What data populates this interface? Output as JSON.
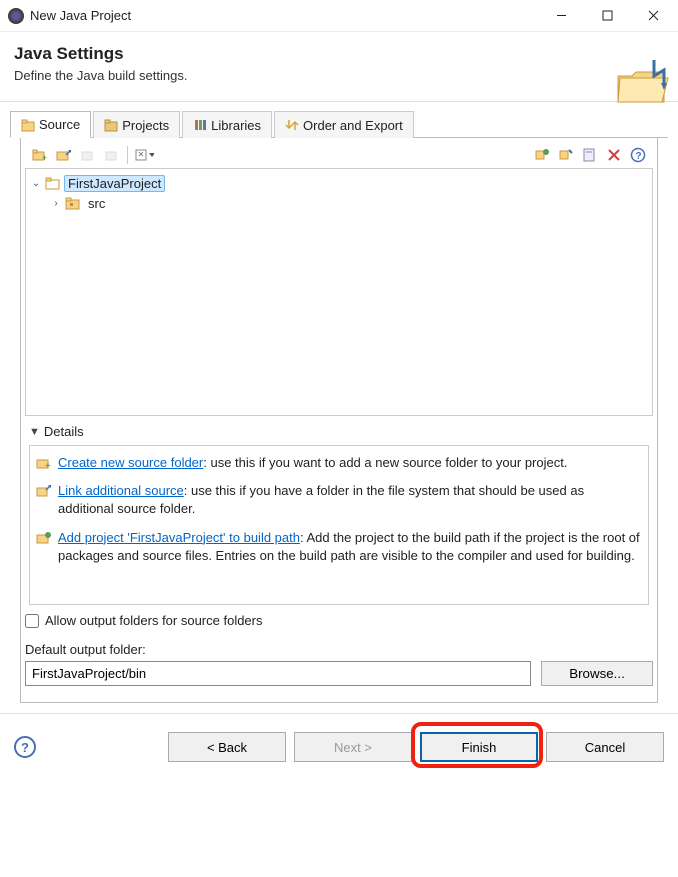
{
  "window": {
    "title": "New Java Project"
  },
  "header": {
    "title": "Java Settings",
    "subtitle": "Define the Java build settings."
  },
  "tabs": {
    "source": "Source",
    "projects": "Projects",
    "libraries": "Libraries",
    "order": "Order and Export"
  },
  "tree": {
    "project": "FirstJavaProject",
    "src": "src"
  },
  "details": {
    "heading": "Details",
    "item1_link": "Create new source folder",
    "item1_rest": ": use this if you want to add a new source folder to your project.",
    "item2_link": "Link additional source",
    "item2_rest": ": use this if you have a folder in the file system that should be used as additional source folder.",
    "item3_link": "Add project 'FirstJavaProject' to build path",
    "item3_rest": ": Add the project to the build path if the project is the root of packages and source files. Entries on the build path are visible to the compiler and used for building."
  },
  "allow_output_label": "Allow output folders for source folders",
  "output_label": "Default output folder:",
  "output_value": "FirstJavaProject/bin",
  "browse_label": "Browse...",
  "buttons": {
    "back": "< Back",
    "next": "Next >",
    "finish": "Finish",
    "cancel": "Cancel"
  }
}
